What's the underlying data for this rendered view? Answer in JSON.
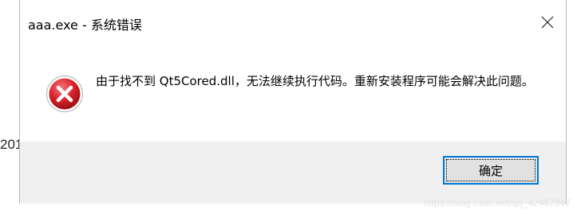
{
  "background": {
    "fragment_text": "201"
  },
  "dialog": {
    "title": "aaa.exe - 系统错误",
    "close_icon": "close-icon",
    "status_icon": "error-icon",
    "message": "由于找不到 Qt5Cored.dll，无法继续执行代码。重新安装程序可能会解决此问题。",
    "ok_label": "确定",
    "accent_color": "#0078d7",
    "error_color": "#d9242b"
  },
  "watermark": {
    "text": "https://blog.csdn.net/qq_42467347"
  }
}
